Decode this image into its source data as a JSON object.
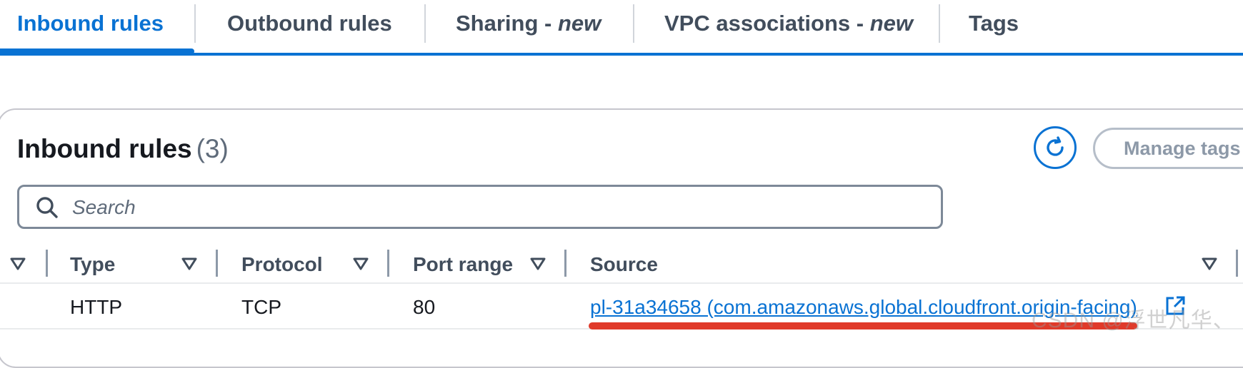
{
  "tabs": [
    {
      "label": "Inbound rules",
      "suffix": ""
    },
    {
      "label": "Outbound rules",
      "suffix": ""
    },
    {
      "label": "Sharing - ",
      "suffix": "new"
    },
    {
      "label": "VPC associations - ",
      "suffix": "new"
    },
    {
      "label": "Tags",
      "suffix": ""
    }
  ],
  "panel": {
    "title": "Inbound rules",
    "count": "(3)",
    "manage_tags_label": "Manage tags",
    "refresh_icon": "refresh-icon"
  },
  "search": {
    "placeholder": "Search",
    "value": "",
    "icon": "search-icon"
  },
  "table": {
    "columns": [
      "Type",
      "Protocol",
      "Port range",
      "Source"
    ],
    "rows": [
      {
        "type": "HTTP",
        "protocol": "TCP",
        "port_range": "80",
        "source": "pl-31a34658 (com.amazonaws.global.cloudfront.origin-facing)",
        "source_icon": "external-link-icon"
      }
    ]
  },
  "annotation": {
    "color": "#e03a2a"
  },
  "watermark": "CSDN @浮世凡华、",
  "colors": {
    "accent": "#0972d3",
    "text": "#16191f",
    "muted": "#414d5c"
  }
}
